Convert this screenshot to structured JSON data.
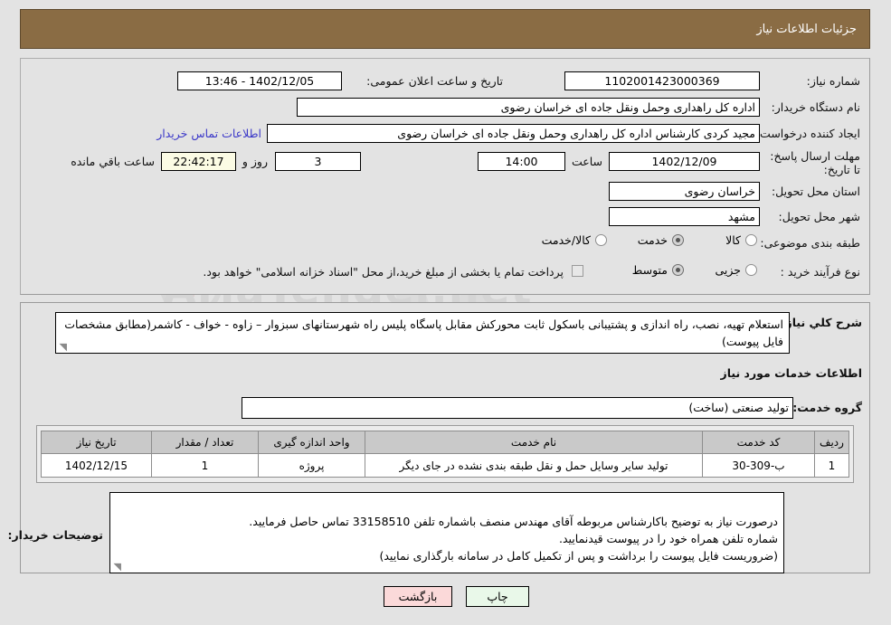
{
  "header": {
    "title": "جزئیات اطلاعات نیاز"
  },
  "info": {
    "labels": {
      "need_number": "شماره نیاز:",
      "buyer_org": "نام دستگاه خریدار:",
      "requester": "ایجاد کننده درخواست:",
      "deadline": "مهلت ارسال پاسخ: تا تاریخ:",
      "province": "استان محل تحویل:",
      "city": "شهر محل تحویل:",
      "category": "طبقه بندی موضوعی:",
      "purchase_type": "نوع فرآیند خرید :",
      "public_announce_datetime": "تاریخ و ساعت اعلان عمومی:",
      "hour": "ساعت",
      "days_and": "روز و",
      "hours_remaining": "ساعت باقي مانده"
    },
    "values": {
      "need_number": "1102001423000369",
      "buyer_org": "اداره کل راهداری وحمل ونقل جاده ای خراسان رضوی",
      "requester": "مجید کردی کارشناس اداره کل راهداری وحمل ونقل جاده ای خراسان رضوی",
      "deadline_date": "1402/12/09",
      "deadline_time": "14:00",
      "days_left": "3",
      "time_left": "22:42:17",
      "province": "خراسان رضوی",
      "city": "مشهد",
      "public_announce_datetime": "1402/12/05 - 13:46"
    },
    "contact_link": "اطلاعات تماس خریدار",
    "category_options": [
      {
        "label": "کالا",
        "selected": false
      },
      {
        "label": "خدمت",
        "selected": true
      },
      {
        "label": "کالا/خدمت",
        "selected": false
      }
    ],
    "purchase_options": [
      {
        "label": "جزیی",
        "selected": false
      },
      {
        "label": "متوسط",
        "selected": true
      }
    ],
    "treasury_checkbox": {
      "checked": false,
      "text": "پرداخت تمام یا بخشی از مبلغ خرید،از محل \"اسناد خزانه اسلامی\" خواهد بود."
    }
  },
  "description": {
    "general_label": "شرح کلي نياز:",
    "general_text": "استعلام تهیه، نصب، راه اندازی و پشتیبانی باسکول ثابت محورکش مقابل پاسگاه پلیس راه  شهرستانهای سبزوار – زاوه - خواف - کاشمر(مطابق مشخصات فایل پیوست)",
    "services_heading": "اطلاعات خدمات مورد نیاز",
    "service_group_label": "گروه خدمت:",
    "service_group_value": "تولید صنعتی (ساخت)",
    "buyer_notes_label": "توضیحات خریدار:",
    "buyer_notes_text": "درصورت نیاز به توضیح باکارشناس مربوطه آقای مهندس منصف باشماره تلفن 33158510 تماس حاصل فرمایید.\nشماره تلفن همراه خود را در پیوست قیدنمایید.\n(ضروریست فایل پیوست را برداشت و پس از تکمیل کامل در سامانه بارگذاری نمایید)"
  },
  "table": {
    "headers": [
      "ردیف",
      "کد خدمت",
      "نام خدمت",
      "واحد اندازه گیری",
      "تعداد / مقدار",
      "تاریخ نیاز"
    ],
    "rows": [
      {
        "row": "1",
        "code": "ب-309-30",
        "name": "تولید سایر وسایل حمل و نقل طبقه بندی نشده در جای دیگر",
        "unit": "پروژه",
        "quantity": "1",
        "need_date": "1402/12/15"
      }
    ]
  },
  "footer": {
    "print_label": "چاپ",
    "back_label": "بازگشت"
  },
  "watermark": {
    "text": "AriaTender.net"
  },
  "colors": {
    "header_bg": "#8a6c44",
    "page_bg": "#e3e3e3",
    "link": "#3b38c8",
    "back_btn_bg": "#fbd9d9",
    "print_btn_bg": "#e9f8e9",
    "countdown_bg": "#fbfbe4",
    "table_header_bg": "#c9c9c9"
  }
}
